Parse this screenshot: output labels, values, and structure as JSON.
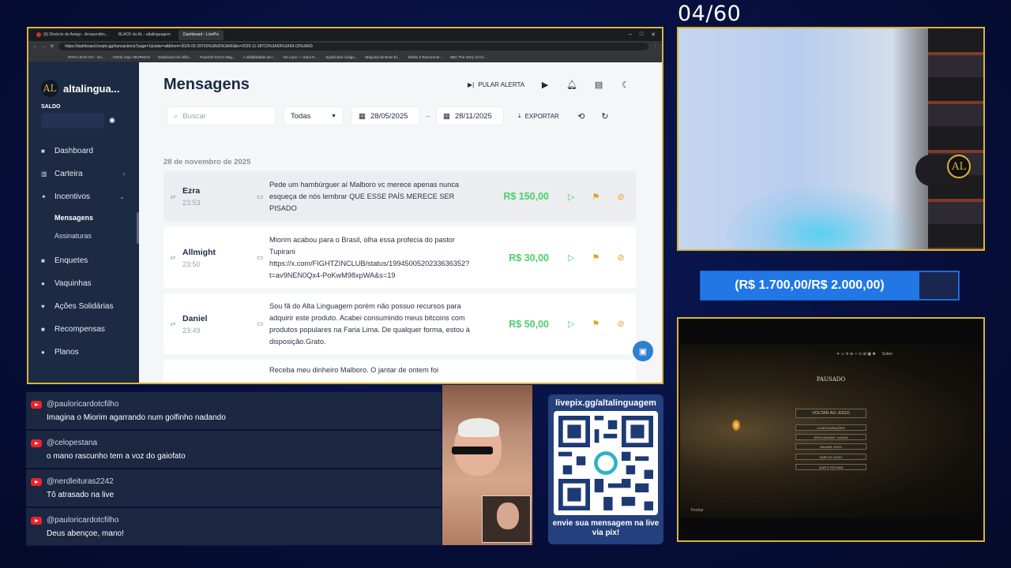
{
  "stream": {
    "counter": "04/60",
    "goal": "(R$ 1.700,00/R$ 2.000,00)",
    "goal_progress": 0.85
  },
  "browser": {
    "tabs": [
      {
        "label": "(9) Divórcio do Amigo - Arrependim...",
        "active": false
      },
      {
        "label": "BLACK do AL - altalinguagem",
        "active": false
      },
      {
        "label": "Dashboard - LivePix",
        "active": true
      }
    ],
    "url": "https://dashboard.livepix.gg/transactions?page=1&state=all&from=2025-05-28T00%3A00%3A00&to=2025-11-28T23%3A59%3A59-03%3A00",
    "bookmarks": [
      "PAPA LEÃO XIV - Go...",
      "VOCÊ Hoje: MIORMAS",
      "Dashboard de Afilia...",
      "Powerful SOLO Mag...",
      "A infalibilidade da I...",
      "De Lacio — Saint R...",
      "Significado código...",
      "Máquina de Bose El...",
      "Diablo 2 Resurrecte...",
      "BBC The Story of Ch..."
    ]
  },
  "sidebar": {
    "brand": "altalingua...",
    "brand_logo": "AL",
    "saldo_label": "SALDO",
    "items": [
      {
        "label": "Dashboard",
        "icon": "dashboard-icon",
        "glyph": "■"
      },
      {
        "label": "Carteira",
        "icon": "bank-icon",
        "glyph": "▥",
        "chevron": "›"
      },
      {
        "label": "Incentivos",
        "icon": "sparkle-icon",
        "glyph": "✦",
        "chevron": "⌄"
      },
      {
        "label": "Enquetes",
        "icon": "poll-icon",
        "glyph": "■"
      },
      {
        "label": "Vaquinhas",
        "icon": "piggy-icon",
        "glyph": "●"
      },
      {
        "label": "Ações Solidárias",
        "icon": "hands-icon",
        "glyph": "♥"
      },
      {
        "label": "Recompensas",
        "icon": "gift-icon",
        "glyph": "■"
      },
      {
        "label": "Planos",
        "icon": "plans-icon",
        "glyph": "●"
      }
    ],
    "sub_items": [
      {
        "label": "Mensagens",
        "active": true
      },
      {
        "label": "Assinaturas",
        "active": false
      }
    ]
  },
  "main": {
    "title": "Mensagens",
    "skip_alert": "PULAR ALERTA",
    "search_placeholder": "Buscar",
    "filter_select": "Todas",
    "date_from": "28/05/2025",
    "date_sep": "–",
    "date_to": "28/11/2025",
    "export": "EXPORTAR",
    "date_header": "28 de novembro de 2025",
    "messages": [
      {
        "name": "Ezra",
        "time": "23:53",
        "text": "Pede um hambúrguer aí Malboro vc merece apenas nunca esqueça de nós lembrar QUE ESSE PAÍS MERECE SER PISADO",
        "amount": "R$ 150,00"
      },
      {
        "name": "Allmight",
        "time": "23:50",
        "text": "Miorim acabou para o Brasil, olha essa profecia do pastor Tupirani https://x.com/FIGHTZINCLUB/status/1994500520233636352?t=av9NEN0Qx4-PoKwM98xpWA&s=19",
        "amount": "R$ 30,00"
      },
      {
        "name": "Daniel",
        "time": "23:49",
        "text": "Sou fã do Alta Linguagem porém não possuo recursos para adquirir este produto. Acabei consumindo meus bitcoins com produtos populares na Faria Lima. De qualquer forma, estou à disposição.Grato.",
        "amount": "R$ 50,00"
      },
      {
        "name": "",
        "time": "",
        "text": "Receba meu dinheiro Malboro. O jantar de ontem foi",
        "amount": ""
      }
    ]
  },
  "chat": [
    {
      "user": "@pauloricardotcfilho",
      "text": "Imagina o Miorim agarrando num golfinho nadando"
    },
    {
      "user": "@celopestana",
      "text": "o mano rascunho tem a voz do gaiofato"
    },
    {
      "user": "@nerdleituras2242",
      "text": "Tô atrasado na live"
    },
    {
      "user": "@pauloricardotcfilho",
      "text": "Deus abençoe, mano!"
    }
  ],
  "qr": {
    "title": "livepix.gg/altalinguagem",
    "footer": "envie sua mensagem na live via pix!"
  },
  "game": {
    "paused_title": "PAUSADO",
    "resume_button": "VOLTAR AO JOGO",
    "menu_items": [
      "CONFIGURAÇÕES",
      "DIFICULDADE / AJUDA",
      "SALVAR JOGO",
      "SAIR DO JOGO",
      "SAIR E FECHAR"
    ],
    "hud_right": "Sobre",
    "footer": "Fechar"
  },
  "colors": {
    "frame_gold": "#d9b43a",
    "amount_green": "#4ccf6c",
    "flag_orange": "#e0a21a",
    "goal_blue": "#2277e6"
  }
}
